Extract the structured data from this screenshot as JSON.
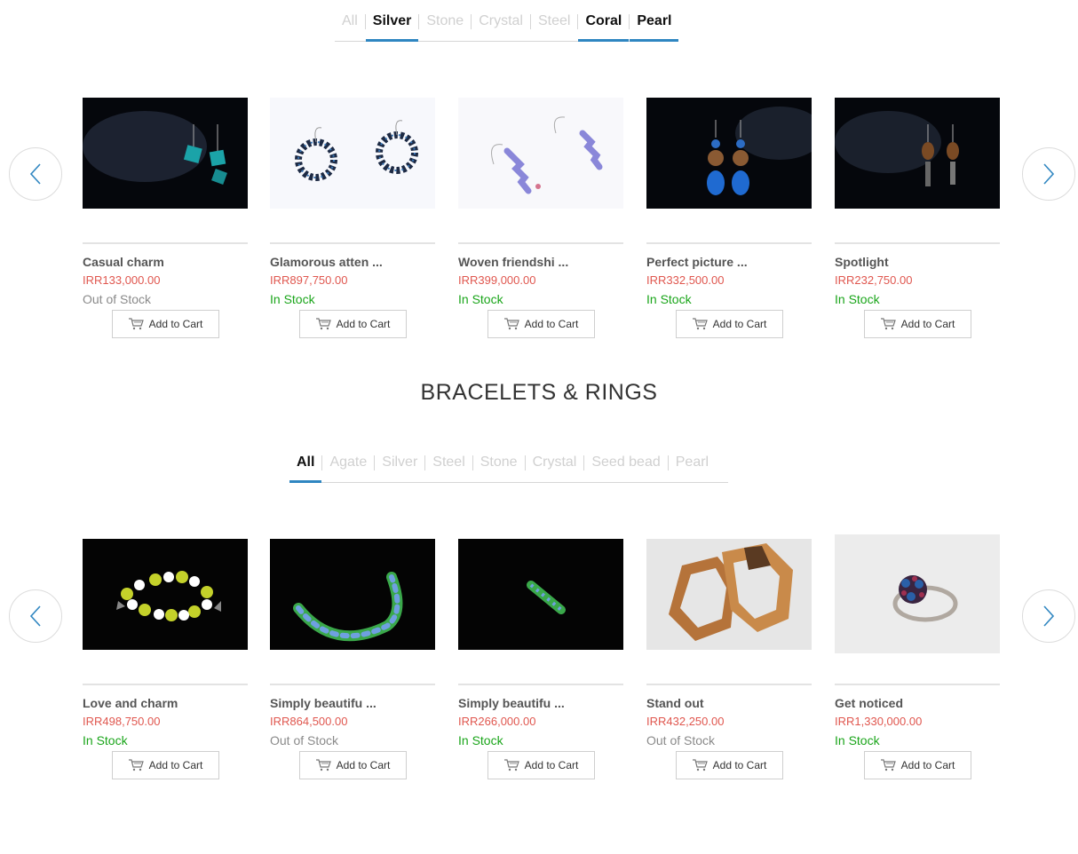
{
  "earrings": {
    "tabs": [
      {
        "label": "All",
        "active": false
      },
      {
        "label": "Silver",
        "active": true
      },
      {
        "label": "Stone",
        "active": false
      },
      {
        "label": "Crystal",
        "active": false
      },
      {
        "label": "Steel",
        "active": false
      },
      {
        "label": "Coral",
        "active": true
      },
      {
        "label": "Pearl",
        "active": true
      }
    ],
    "products": [
      {
        "name": "Casual charm",
        "price": "IRR133,000.00",
        "stock": "Out of Stock",
        "in_stock": false,
        "image": "dark"
      },
      {
        "name": "Glamorous atten ...",
        "price": "IRR897,750.00",
        "stock": "In Stock",
        "in_stock": true,
        "image": "light"
      },
      {
        "name": "Woven friendshi ...",
        "price": "IRR399,000.00",
        "stock": "In Stock",
        "in_stock": true,
        "image": "light"
      },
      {
        "name": "Perfect picture ...",
        "price": "IRR332,500.00",
        "stock": "In Stock",
        "in_stock": true,
        "image": "dark"
      },
      {
        "name": "Spotlight",
        "price": "IRR232,750.00",
        "stock": "In Stock",
        "in_stock": true,
        "image": "dark"
      }
    ]
  },
  "bracelets": {
    "heading": "BRACELETS & RINGS",
    "tabs": [
      {
        "label": "All",
        "active": true
      },
      {
        "label": "Agate",
        "active": false
      },
      {
        "label": "Silver",
        "active": false
      },
      {
        "label": "Steel",
        "active": false
      },
      {
        "label": "Stone",
        "active": false
      },
      {
        "label": "Crystal",
        "active": false
      },
      {
        "label": "Seed bead",
        "active": false
      },
      {
        "label": "Pearl",
        "active": false
      }
    ],
    "products": [
      {
        "name": "Love and charm",
        "price": "IRR498,750.00",
        "stock": "In Stock",
        "in_stock": true,
        "image": "dark"
      },
      {
        "name": "Simply beautifu ...",
        "price": "IRR864,500.00",
        "stock": "Out of Stock",
        "in_stock": false,
        "image": "dark"
      },
      {
        "name": "Simply beautifu ...",
        "price": "IRR266,000.00",
        "stock": "In Stock",
        "in_stock": true,
        "image": "dark"
      },
      {
        "name": "Stand out",
        "price": "IRR432,250.00",
        "stock": "Out of Stock",
        "in_stock": false,
        "image": "grey"
      },
      {
        "name": "Get noticed",
        "price": "IRR1,330,000.00",
        "stock": "In Stock",
        "in_stock": true,
        "image": "grey"
      }
    ]
  },
  "add_to_cart_label": "Add to Cart",
  "icons": {
    "prev": "chevron-left-icon",
    "next": "chevron-right-icon",
    "cart": "cart-icon"
  },
  "colors": {
    "accent": "#2f86c1",
    "price": "#e0574f",
    "in_stock": "#1aa51a",
    "out_of_stock": "#8a8a8a"
  }
}
